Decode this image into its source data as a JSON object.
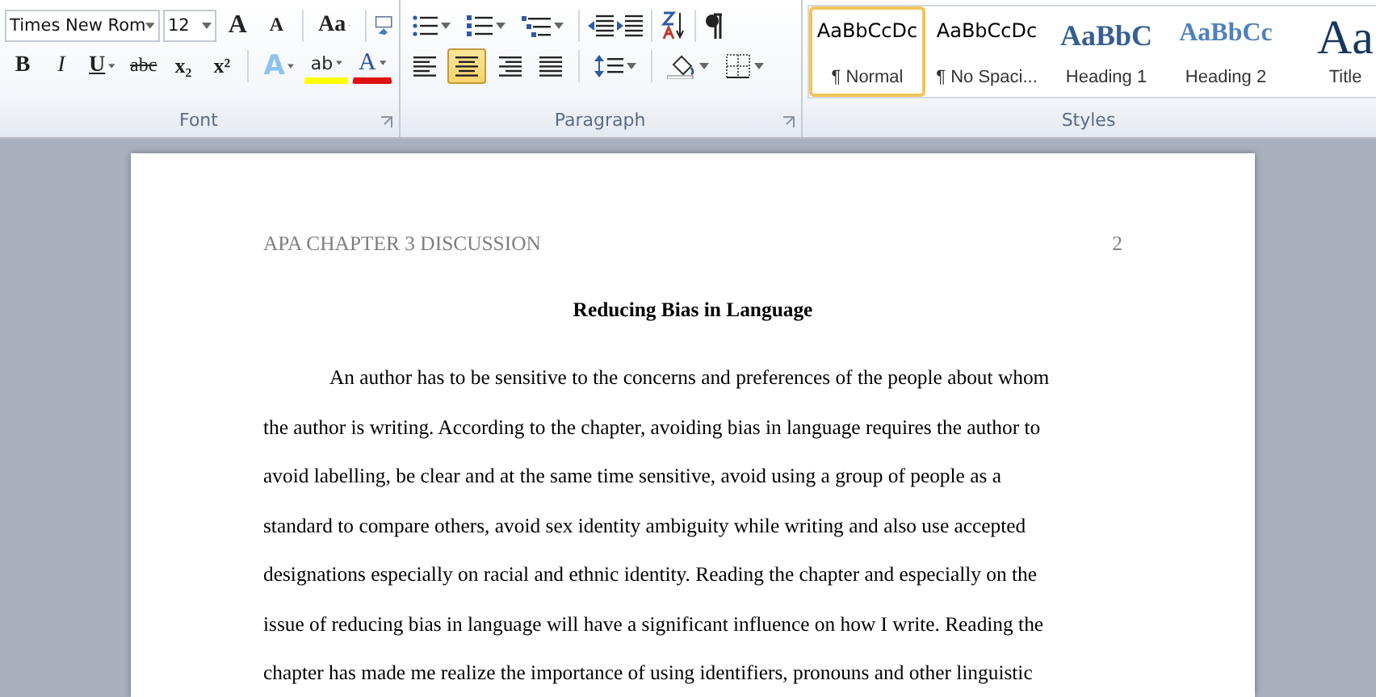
{
  "font": {
    "name_field": "Times New Rom",
    "size_field": "12",
    "grow_button": "A",
    "shrink_button": "A",
    "case_button": "Aa",
    "bold": "B",
    "italic": "I",
    "underline": "U",
    "strike": "abc",
    "subscript": "x₂",
    "superscript": "x²",
    "effects": "A",
    "highlight": "ab",
    "font_color_button": "A",
    "label": "Font"
  },
  "paragraph": {
    "alignments": [
      {
        "selected": false
      },
      {
        "selected": true
      },
      {
        "selected": false
      },
      {
        "selected": false
      }
    ],
    "label": "Paragraph"
  },
  "styles": {
    "items": [
      {
        "preview": "AaBbCcDc",
        "name": "¶ Normal",
        "kind": "normal",
        "selected": true
      },
      {
        "preview": "AaBbCcDc",
        "name": "¶ No Spaci...",
        "kind": "normal",
        "selected": false
      },
      {
        "preview": "AaBbC",
        "name": "Heading 1",
        "kind": "heading1",
        "selected": false
      },
      {
        "preview": "AaBbCc",
        "name": "Heading 2",
        "kind": "heading2",
        "selected": false
      },
      {
        "preview": "Aa",
        "name": "Title",
        "kind": "title",
        "selected": false
      }
    ],
    "label": "Styles"
  },
  "document": {
    "header_title": "APA CHAPTER 3 DISCUSSION",
    "page_number": "2",
    "title": "Reducing Bias in Language",
    "paragraphs": [
      {
        "indent": true,
        "lines": [
          "An author has to be sensitive to the concerns and preferences of the people about whom",
          "the author is writing. According to the chapter, avoiding bias in language requires the author to",
          "avoid labelling, be clear and at the same time sensitive, avoid using a group of people as a",
          "standard to compare others, avoid sex identity ambiguity while writing and also use accepted",
          "designations especially on racial and ethnic identity. Reading the chapter and especially on the",
          "issue of reducing bias in language will have a significant influence on how I write. Reading the",
          "chapter has made me realize the importance of using identifiers, pronouns and other linguistic"
        ]
      }
    ]
  }
}
